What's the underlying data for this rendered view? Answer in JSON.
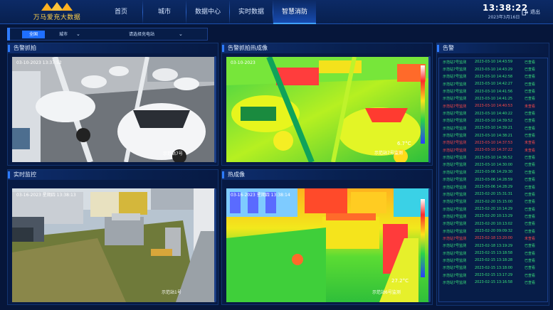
{
  "header": {
    "brand_name": "万马爱充大数据",
    "nav": [
      {
        "label": "首页",
        "active": false
      },
      {
        "label": "城市",
        "active": false
      },
      {
        "label": "数据中心",
        "active": false
      },
      {
        "label": "实时数据",
        "active": false
      },
      {
        "label": "智慧消防",
        "active": true
      }
    ],
    "clock_time": "13:38:22",
    "clock_date": "2023年3月16日",
    "logout_label": "退出"
  },
  "filters": {
    "all_label": "全国",
    "city_label": "城市",
    "station_label": "请选择充电站"
  },
  "panels": {
    "alarm_capture": {
      "title": "告警抓拍",
      "overlay_timestamp": "03-10-2023 13:37:52",
      "overlay_caption": "示范站7号"
    },
    "alarm_capture_thermal": {
      "title": "告警抓拍热成像",
      "overlay_timestamp": "03-10-2023",
      "overlay_temp": "6.7°C",
      "overlay_caption": "示范站7号监测"
    },
    "live_monitor": {
      "title": "实时监控",
      "overlay_timestamp": "03-16-2023 星期四 13:38:13",
      "overlay_caption": "示范站1号"
    },
    "thermal": {
      "title": "热成像",
      "overlay_timestamp": "03-16-2023 星期四 13:38:14",
      "overlay_temp": "27.2°C",
      "overlay_caption": "示范站6号监测"
    },
    "alarms": {
      "title": "告警"
    }
  },
  "alarms": [
    {
      "name": "示范站7号监测",
      "time": "2023-03-10 14:43:59",
      "status": "已查看",
      "read": true
    },
    {
      "name": "示范站7号监测",
      "time": "2023-03-10 14:43:29",
      "status": "已查看",
      "read": true
    },
    {
      "name": "示范站7号监测",
      "time": "2023-03-10 14:42:58",
      "status": "已查看",
      "read": true
    },
    {
      "name": "示范站7号监测",
      "time": "2023-03-10 14:42:27",
      "status": "已查看",
      "read": true
    },
    {
      "name": "示范站7号监测",
      "time": "2023-03-10 14:41:56",
      "status": "已查看",
      "read": true
    },
    {
      "name": "示范站7号监测",
      "time": "2023-03-10 14:41:25",
      "status": "已查看",
      "read": true
    },
    {
      "name": "示范站7号监测",
      "time": "2023-03-10 14:40:53",
      "status": "未查看",
      "read": false
    },
    {
      "name": "示范站7号监测",
      "time": "2023-03-10 14:40:22",
      "status": "已查看",
      "read": true
    },
    {
      "name": "示范站7号监测",
      "time": "2023-03-10 14:39:52",
      "status": "已查看",
      "read": true
    },
    {
      "name": "示范站7号监测",
      "time": "2023-03-10 14:39:21",
      "status": "已查看",
      "read": true
    },
    {
      "name": "示范站7号监测",
      "time": "2023-03-10 14:38:21",
      "status": "已查看",
      "read": true
    },
    {
      "name": "示范站7号监测",
      "time": "2023-03-10 14:37:53",
      "status": "未查看",
      "read": false
    },
    {
      "name": "示范站7号监测",
      "time": "2023-03-10 14:37:22",
      "status": "未查看",
      "read": false
    },
    {
      "name": "示范站7号监测",
      "time": "2023-03-10 14:36:52",
      "status": "已查看",
      "read": true
    },
    {
      "name": "示范站7号监测",
      "time": "2023-03-10 14:30:00",
      "status": "已查看",
      "read": true
    },
    {
      "name": "示范站7号监测",
      "time": "2023-03-06 14:29:30",
      "status": "已查看",
      "read": true
    },
    {
      "name": "示范站7号监测",
      "time": "2023-03-06 14:28:59",
      "status": "已查看",
      "read": true
    },
    {
      "name": "示范站7号监测",
      "time": "2023-03-06 14:28:29",
      "status": "已查看",
      "read": true
    },
    {
      "name": "示范站7号监测",
      "time": "2023-02-20 15:31:31",
      "status": "已查看",
      "read": true
    },
    {
      "name": "示范站7号监测",
      "time": "2023-02-20 15:15:00",
      "status": "已查看",
      "read": true
    },
    {
      "name": "示范站7号监测",
      "time": "2023-02-20 10:14:29",
      "status": "已查看",
      "read": true
    },
    {
      "name": "示范站7号监测",
      "time": "2023-02-20 10:13:29",
      "status": "已查看",
      "read": true
    },
    {
      "name": "示范站7号监测",
      "time": "2023-02-20 10:13:02",
      "status": "已查看",
      "read": true
    },
    {
      "name": "示范站7号监测",
      "time": "2023-02-20 09:09:32",
      "status": "已查看",
      "read": true
    },
    {
      "name": "示范站7号监测",
      "time": "2023-02-18 13:20:00",
      "status": "未查看",
      "read": false
    },
    {
      "name": "示范站7号监测",
      "time": "2023-02-18 13:19:29",
      "status": "已查看",
      "read": true
    },
    {
      "name": "示范站7号监测",
      "time": "2023-02-15 13:18:58",
      "status": "已查看",
      "read": true
    },
    {
      "name": "示范站7号监测",
      "time": "2023-02-15 13:18:28",
      "status": "已查看",
      "read": true
    },
    {
      "name": "示范站7号监测",
      "time": "2023-02-15 13:18:00",
      "status": "已查看",
      "read": true
    },
    {
      "name": "示范站7号监测",
      "time": "2023-02-15 13:17:29",
      "status": "已查看",
      "read": true
    },
    {
      "name": "示范站7号监测",
      "time": "2023-02-15 13:16:58",
      "status": "已查看",
      "read": true
    }
  ]
}
